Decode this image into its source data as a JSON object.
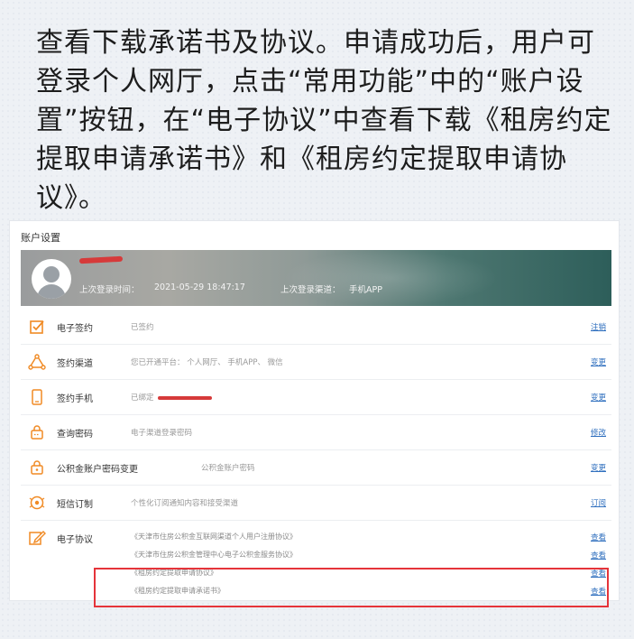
{
  "instruction": "查看下载承诺书及协议。申请成功后，用户可登录个人网厅，点击“常用功能”中的“账户设置”按钮，在“电子协议”中查看下载《租房约定提取申请承诺书》和《租房约定提取申请协议》。",
  "panel": {
    "title": "账户设置",
    "last_login_label": "上次登录时间：",
    "last_login_time": "2021-05-29 18:47:17",
    "last_channel_label": "上次登录渠道：",
    "last_channel": "手机APP"
  },
  "rows": [
    {
      "label": "电子签约",
      "desc": "已签约",
      "action": "注销",
      "icon": "checkbox-icon"
    },
    {
      "label": "签约渠道",
      "desc": "您已开通平台： 个人网厅、 手机APP、 微信",
      "action": "变更",
      "icon": "channel-icon"
    },
    {
      "label": "签约手机",
      "desc": "已绑定",
      "action": "变更",
      "icon": "phone-icon"
    },
    {
      "label": "查询密码",
      "desc": "电子渠道登录密码",
      "action": "修改",
      "icon": "lock-icon"
    },
    {
      "label": "公积金账户密码变更",
      "desc": "公积金账户密码",
      "action": "变更",
      "icon": "lock-icon"
    },
    {
      "label": "短信订制",
      "desc": "个性化订阅通知内容和接受渠道",
      "action": "订阅",
      "icon": "sms-icon"
    }
  ],
  "protocols": {
    "label": "电子协议",
    "icon": "edit-icon",
    "items": [
      {
        "name": "《天津市住房公积金互联网渠道个人用户注册协议》",
        "action": "查看"
      },
      {
        "name": "《天津市住房公积金管理中心电子公积金服务协议》",
        "action": "查看"
      },
      {
        "name": "《租房约定提取申请协议》",
        "action": "查看"
      },
      {
        "name": "《租房约定提取申请承诺书》",
        "action": "查看"
      }
    ]
  },
  "colors": {
    "accent": "#f08a24",
    "link": "#2f6fbe",
    "highlight": "#e5343a"
  }
}
